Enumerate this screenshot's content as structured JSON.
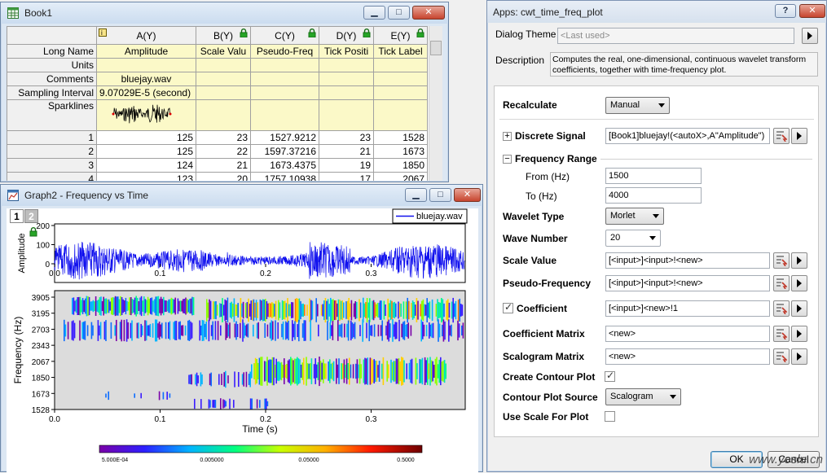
{
  "book": {
    "title": "Book1",
    "columns": [
      {
        "label": "A(Y)",
        "locked": false
      },
      {
        "label": "B(Y)",
        "locked": true
      },
      {
        "label": "C(Y)",
        "locked": true
      },
      {
        "label": "D(Y)",
        "locked": true
      },
      {
        "label": "E(Y)",
        "locked": true
      }
    ],
    "meta_rows": {
      "long_name": {
        "label": "Long Name",
        "values": [
          "Amplitude",
          "Scale Valu",
          "Pseudo-Freq",
          "Tick Positi",
          "Tick Label"
        ]
      },
      "units": {
        "label": "Units"
      },
      "comments": {
        "label": "Comments",
        "value": "bluejay.wav"
      },
      "sampling": {
        "label": "Sampling Interval",
        "value": "9.07029E-5 (second)"
      },
      "sparklines": {
        "label": "Sparklines"
      }
    },
    "rows": [
      {
        "n": "1",
        "a": "125",
        "b": "23",
        "c": "1527.9212",
        "d": "23",
        "e": "1528"
      },
      {
        "n": "2",
        "a": "125",
        "b": "22",
        "c": "1597.37216",
        "d": "21",
        "e": "1673"
      },
      {
        "n": "3",
        "a": "124",
        "b": "21",
        "c": "1673.4375",
        "d": "19",
        "e": "1850"
      },
      {
        "n": "4",
        "a": "123",
        "b": "20",
        "c": "1757.10938",
        "d": "17",
        "e": "2067"
      }
    ]
  },
  "graph": {
    "title": "Graph2 - Frequency vs Time",
    "layers": [
      "1",
      "2"
    ],
    "top_plot": {
      "ylabel": "Amplitude",
      "yticks": [
        "200",
        "100",
        "0"
      ],
      "xticks": [
        "0.0",
        "0.1",
        "0.2",
        "0.3"
      ],
      "legend": "bluejay.wav"
    },
    "bottom_plot": {
      "ylabel": "Frequency (Hz)",
      "xlabel": "Time (s)",
      "yticks": [
        "3905",
        "3195",
        "2703",
        "2343",
        "2067",
        "1850",
        "1673",
        "1528"
      ],
      "xticks": [
        "0.0",
        "0.1",
        "0.2",
        "0.3"
      ]
    },
    "colorbar_ticks": [
      "5.000E-04",
      "0.005000",
      "0.05000",
      "0.5000"
    ]
  },
  "dialog": {
    "title": "Apps: cwt_time_freq_plot",
    "help_label": "?",
    "theme_label": "Dialog Theme",
    "theme_value": "<Last used>",
    "description_label": "Description",
    "description_text": "Computes the real, one-dimensional, continuous wavelet transform coefficients, together with time-frequency plot.",
    "recalculate_label": "Recalculate",
    "recalculate_value": "Manual",
    "discrete_signal_label": "Discrete Signal",
    "discrete_signal_value": "[Book1]bluejay!(<autoX>,A\"Amplitude\")",
    "freq_range_label": "Frequency Range",
    "from_label": "From (Hz)",
    "from_value": "1500",
    "to_label": "To (Hz)",
    "to_value": "4000",
    "wavelet_type_label": "Wavelet Type",
    "wavelet_type_value": "Morlet",
    "wave_number_label": "Wave Number",
    "wave_number_value": "20",
    "scale_value_label": "Scale Value",
    "scale_value_value": "[<input>]<input>!<new>",
    "pseudo_freq_label": "Pseudo-Frequency",
    "pseudo_freq_value": "[<input>]<input>!<new>",
    "coefficient_label": "Coefficient",
    "coefficient_value": "[<input>]<new>!1",
    "coef_matrix_label": "Coefficient Matrix",
    "coef_matrix_value": "<new>",
    "scalogram_matrix_label": "Scalogram Matrix",
    "scalogram_matrix_value": "<new>",
    "create_contour_label": "Create Contour Plot",
    "contour_source_label": "Contour Plot Source",
    "contour_source_value": "Scalogram",
    "use_scale_label": "Use Scale For Plot",
    "ok_label": "OK",
    "cancel_label": "Cancel"
  },
  "watermark": "www.yeslu.cn"
}
